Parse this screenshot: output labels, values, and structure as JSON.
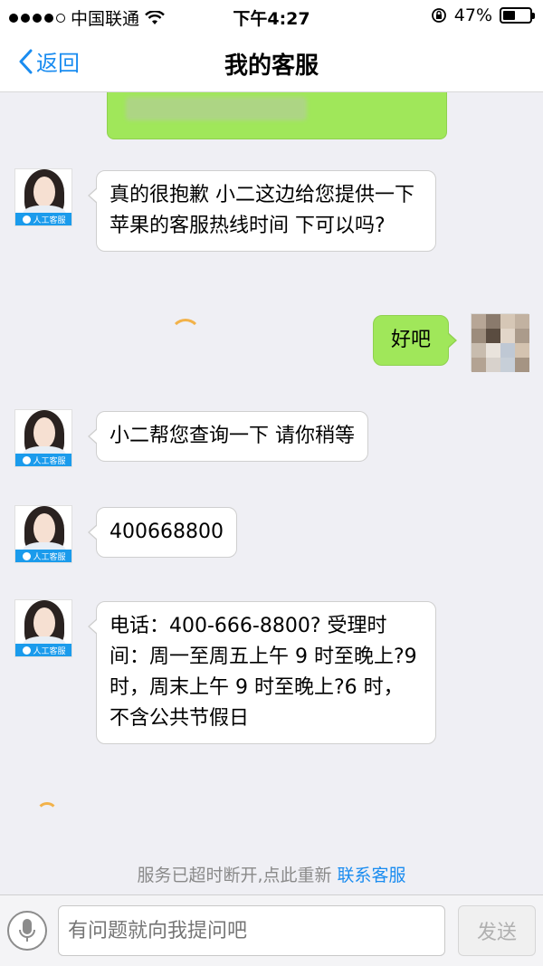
{
  "status_bar": {
    "carrier": "中国联通",
    "time": "下午4:27",
    "battery_text": "47%",
    "battery_level": 0.47
  },
  "nav": {
    "back_label": "返回",
    "title": "我的客服"
  },
  "agent": {
    "badge_label": "人工客服"
  },
  "messages": [
    {
      "from": "agent",
      "text": "真的很抱歉 小二这边给您提供一下苹果的客服热线时间 下可以吗?"
    },
    {
      "from": "user",
      "text": "好吧"
    },
    {
      "from": "agent",
      "text": "小二帮您查询一下 请你稍等"
    },
    {
      "from": "agent",
      "text": "400668800"
    },
    {
      "from": "agent",
      "text": "电话：400-666-8800? 受理时间：周一至周五上午 9 时至晚上?9 时，周末上午 9 时至晚上?6 时，不含公共节假日"
    }
  ],
  "system": {
    "timeout_text": "服务已超时断开,点此重新",
    "contact_link": "联系客服"
  },
  "input": {
    "placeholder": "有问题就向我提问吧",
    "send_label": "发送"
  },
  "colors": {
    "accent": "#1a8cf0",
    "user_bubble": "#a0e75a",
    "badge": "#1a9bec"
  }
}
